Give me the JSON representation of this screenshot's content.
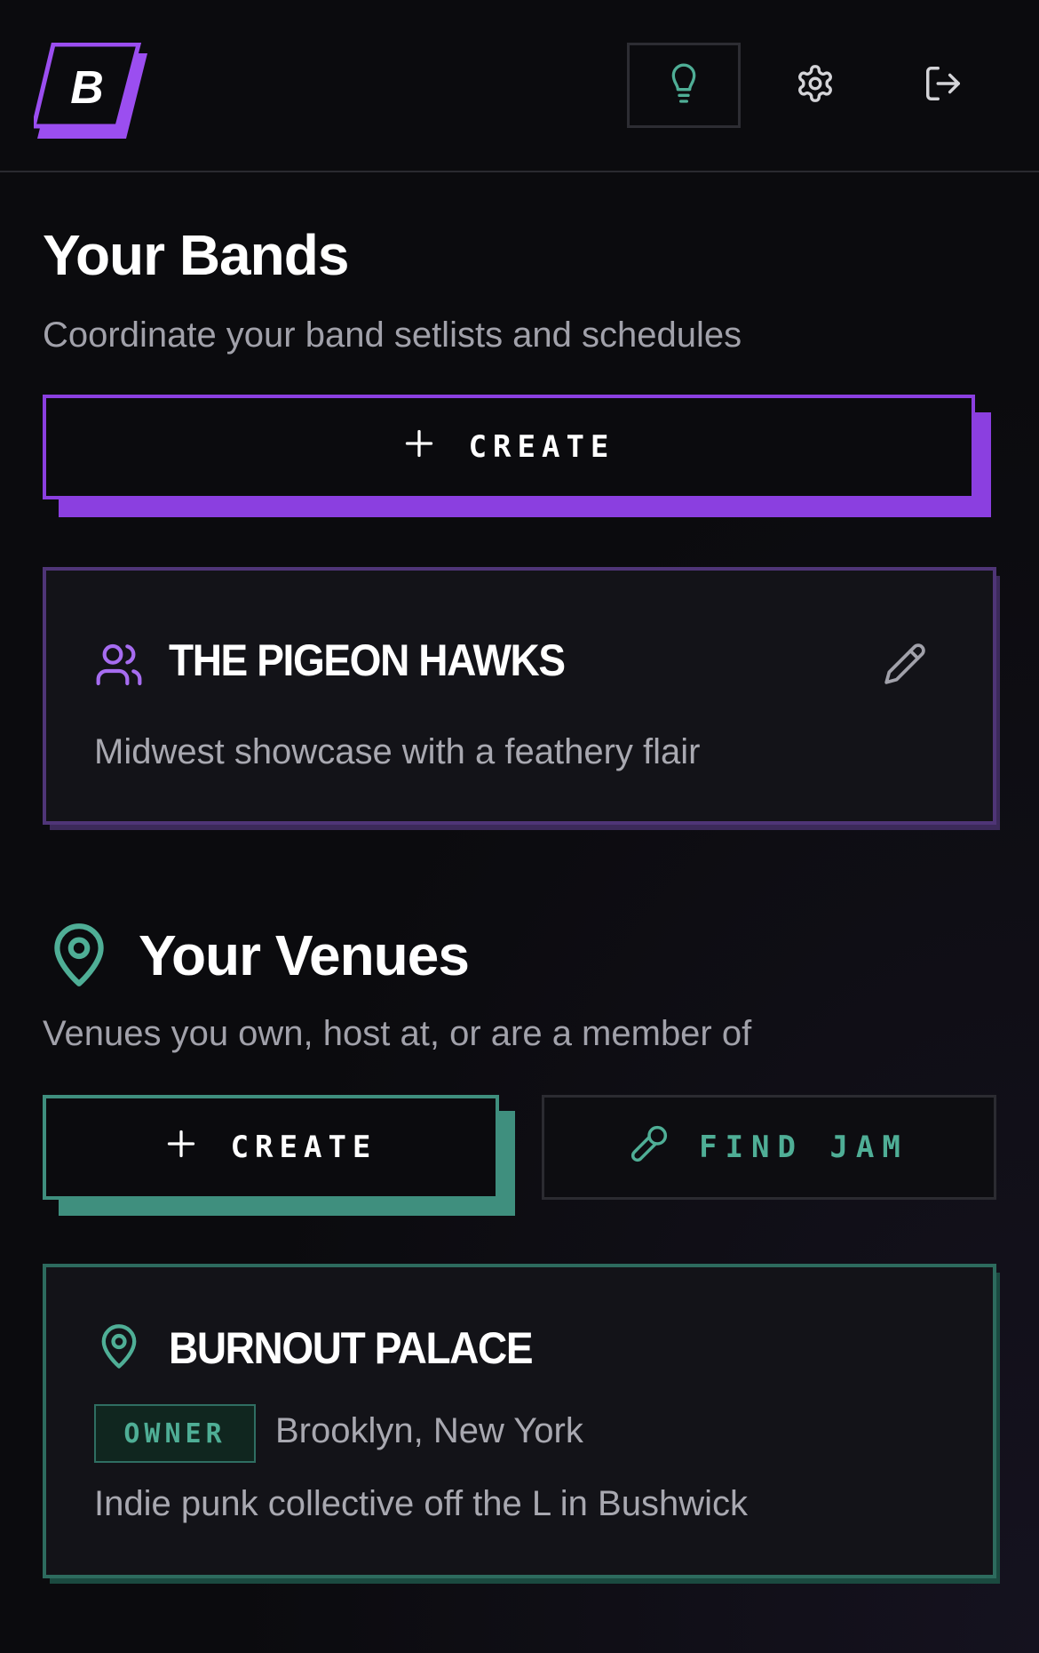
{
  "header": {
    "logo_letter": "B",
    "icons": [
      "lightbulb-icon",
      "gear-icon",
      "logout-icon"
    ]
  },
  "bands": {
    "title": "Your Bands",
    "subtitle": "Coordinate your band setlists and schedules",
    "create_label": "CREATE",
    "items": [
      {
        "name": "THE PIGEON HAWKS",
        "description": "Midwest showcase with a feathery flair"
      }
    ]
  },
  "venues": {
    "title": "Your Venues",
    "subtitle": "Venues you own, host at, or are a member of",
    "create_label": "CREATE",
    "find_jam_label": "FIND JAM",
    "items": [
      {
        "name": "BURNOUT PALACE",
        "role": "OWNER",
        "location": "Brooklyn, New York",
        "description": "Indie punk collective off the L in Bushwick"
      }
    ]
  },
  "colors": {
    "background": "#0b0b0e",
    "purple_accent": "#8b3fe0",
    "teal_accent": "#3f8f7e",
    "muted_text": "#a1a1aa"
  }
}
